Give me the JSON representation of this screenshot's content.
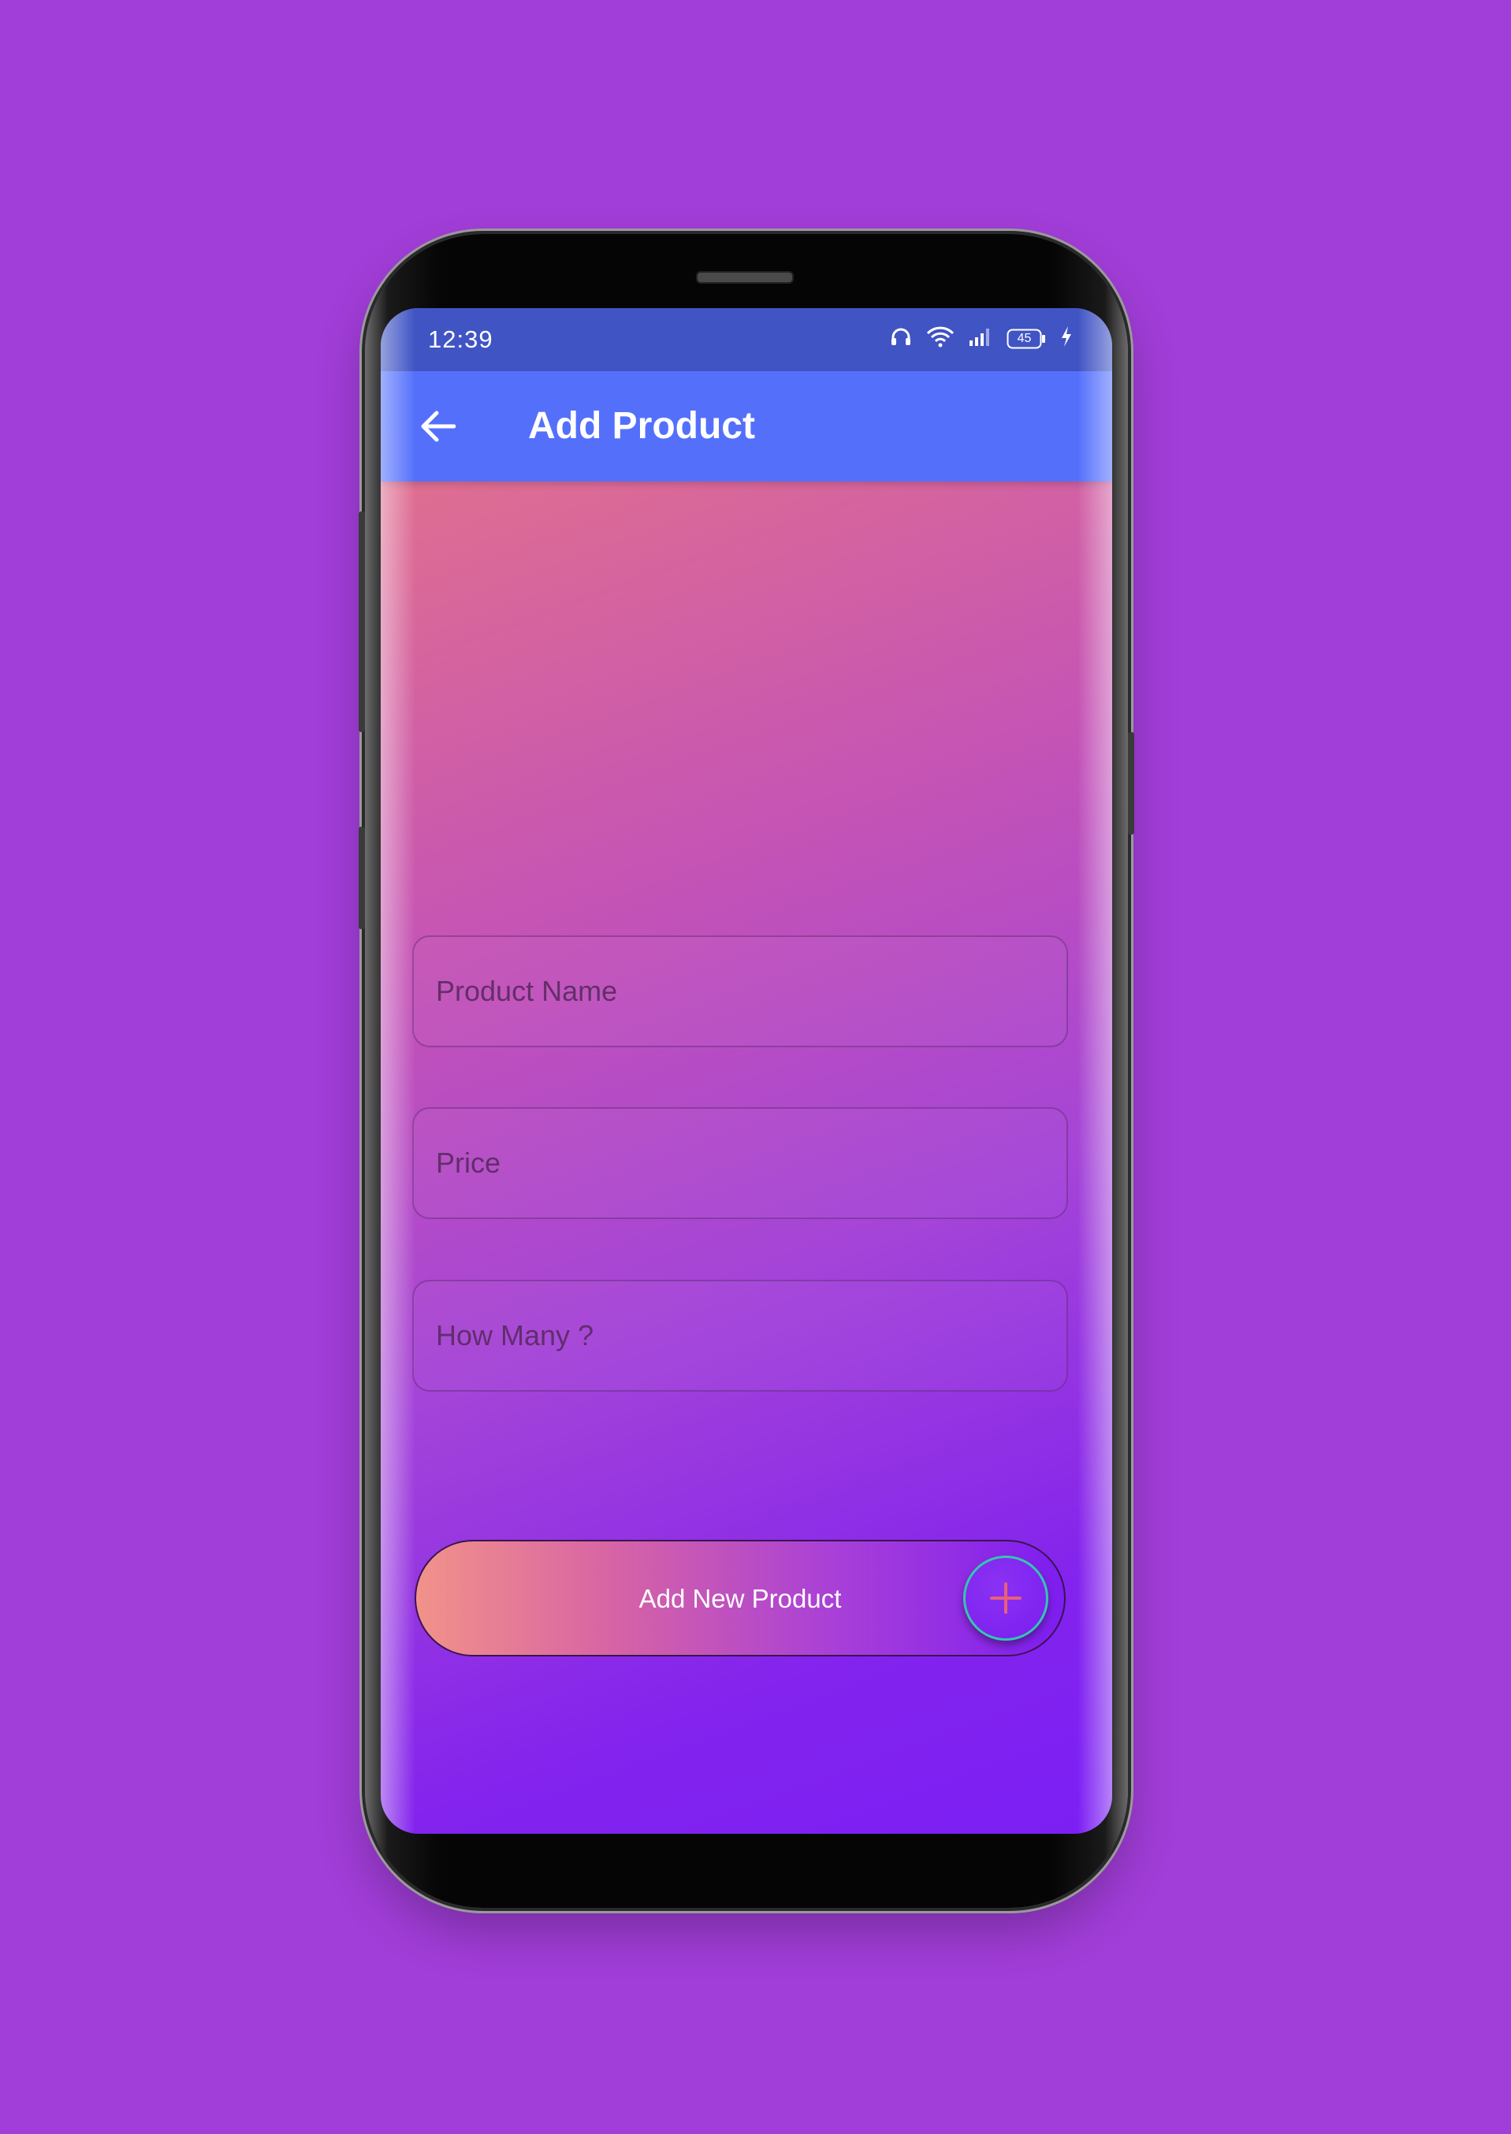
{
  "status_bar": {
    "time": "12:39",
    "battery": "45"
  },
  "appbar": {
    "back_icon": "arrow-left-icon",
    "title": "Add Product"
  },
  "form": {
    "product_name_placeholder": "Product Name",
    "product_name_value": "",
    "price_placeholder": "Price",
    "price_value": "",
    "quantity_placeholder": "How Many ?",
    "quantity_value": ""
  },
  "add_button": {
    "label": "Add New Product",
    "icon": "plus-icon"
  },
  "colors": {
    "background": "#a13dd8",
    "status_bar": "#4054c4",
    "appbar": "#5470fb",
    "gradient_top": "#e97883",
    "gradient_bottom": "#7b1ff5",
    "plus_accent": "#e8607a"
  }
}
